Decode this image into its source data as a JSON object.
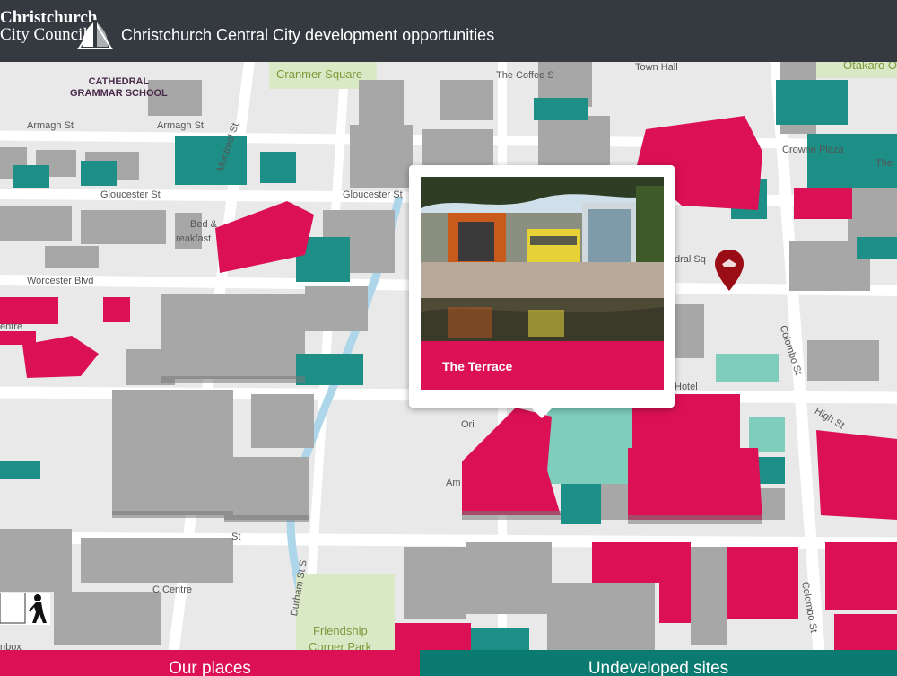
{
  "header": {
    "logo_line1": "Christchurch",
    "logo_line2": "City Council",
    "title": "Christchurch Central City development opportunities"
  },
  "map": {
    "labels": {
      "cathedral_line1": "CATHEDRAL",
      "cathedral_line2": "GRAMMAR SCHOOL",
      "cranmer": "Cranmer Square",
      "coffee": "The Coffee S",
      "townhall": "Town Hall",
      "otakaro": "Otakaro Or",
      "armagh1": "Armagh St",
      "armagh2": "Armagh St",
      "gloucester1": "Gloucester St",
      "gloucester2": "Gloucester St",
      "montreal": "Montreal St",
      "bedbreak1": "Bed &",
      "bedbreak2": "reakfast",
      "worcester": "Worcester Blvd",
      "centre": "entre",
      "crowne": "Crowne Plaza",
      "the": "The",
      "cathedral_sq": "dral Sq",
      "colombo1": "Colombo St",
      "colombo2": "Colombo St",
      "hotel": "Hotel",
      "high": "High St",
      "ori": "Ori",
      "am": "Am",
      "durham": "Durham St S",
      "ccentre": "C Centre",
      "friendship1": "Friendship",
      "friendship2": "Corner Park",
      "box": "nbox",
      "st": "St"
    }
  },
  "popup": {
    "title": "The Terrace"
  },
  "tabs": {
    "places": "Our places",
    "undeveloped": "Undeveloped sites"
  },
  "colors": {
    "header_bg": "#343a40",
    "places": "#db1055",
    "undeveloped": "#0b7a70",
    "pin": "#9b0d16"
  }
}
